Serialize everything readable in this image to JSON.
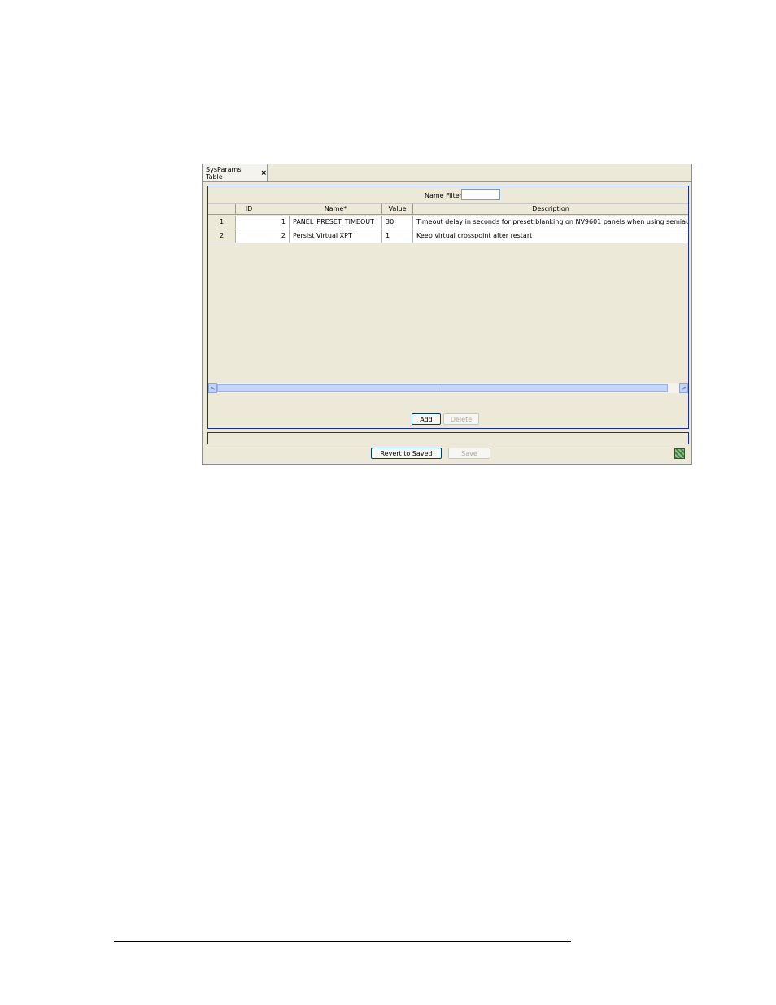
{
  "tab": {
    "label": "SysParams Table",
    "close": "×"
  },
  "filter": {
    "label": "Name Filter:",
    "value": ""
  },
  "table": {
    "headers": [
      "ID",
      "Name*",
      "Value",
      "Description"
    ],
    "rows": [
      {
        "num": "1",
        "id": "1",
        "name": "PANEL_PRESET_TIMEOUT",
        "value": "30",
        "description": "Timeout delay in seconds for preset blanking on NV9601 panels when using semiautomatic data rou"
      },
      {
        "num": "2",
        "id": "2",
        "name": "Persist Virtual XPT",
        "value": "1",
        "description": "Keep virtual crosspoint after restart"
      }
    ]
  },
  "scroll": {
    "left": "<",
    "right": ">"
  },
  "buttons": {
    "add": "Add",
    "delete": "Delete",
    "revert": "Revert to Saved",
    "save": "Save"
  },
  "status_icon": "status-indicator-icon"
}
